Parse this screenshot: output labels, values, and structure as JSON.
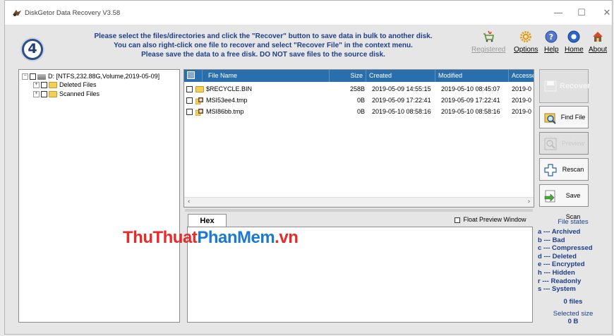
{
  "window": {
    "title": "DiskGetor Data Recovery V3.58",
    "minimize": "—",
    "maximize": "☐",
    "close": "✕"
  },
  "step": "4",
  "instructions": [
    "Please select the files/directories and click the \"Recover\" button to save data in bulk to another disk.",
    "You can also right-click one file to recover and select \"Recover File\" in the context menu.",
    "Please save the data to a free disk. DO NOT save files to the source disk."
  ],
  "toolbar": {
    "registered": "Registered",
    "options": "Options",
    "help": "Help",
    "home": "Home",
    "about": "About"
  },
  "tree": {
    "root": "D: [NTFS,232.88G,Volume,2019-05-09]",
    "children": [
      "Deleted Files",
      "Scanned Files"
    ]
  },
  "file_list": {
    "columns": [
      "File Name",
      "Size",
      "Created",
      "Modified",
      "Accesse"
    ],
    "rows": [
      {
        "name": "$RECYCLE.BIN",
        "size": "258B",
        "created": "2019-05-09 14:55:15",
        "modified": "2019-05-10 08:45:07",
        "accessed": "2019-0"
      },
      {
        "name": "MSI53ee4.tmp",
        "size": "0B",
        "created": "2019-05-09 17:22:41",
        "modified": "2019-05-09 17:22:41",
        "accessed": "2019-0"
      },
      {
        "name": "MSI86bb.tmp",
        "size": "0B",
        "created": "2019-05-10 08:58:16",
        "modified": "2019-05-10 08:58:16",
        "accessed": "2019-0"
      }
    ]
  },
  "hex_tab": "Hex",
  "float_preview": "Float Preview Window",
  "watermark": {
    "part1": "ThuThuat",
    "part2": "PhanMem",
    "part3": ".vn"
  },
  "buttons": {
    "recover": "Recover",
    "find_file": "Find File",
    "preview_file": "Preview File",
    "rescan": "Rescan",
    "save_scan": "Save Scan"
  },
  "file_states": {
    "header": "File states",
    "states": [
      "a --- Archived",
      "b --- Bad",
      "c --- Compressed",
      "d --- Deleted",
      "e --- Encrypted",
      "h --- Hidden",
      "r --- Readonly",
      "s --- System"
    ],
    "files_count": "0 files",
    "selected_size_label": "Selected size",
    "selected_size_value": "0 B"
  },
  "colors": {
    "header_blue": "#2a6fad",
    "instruction_blue": "#1f3e8a"
  }
}
